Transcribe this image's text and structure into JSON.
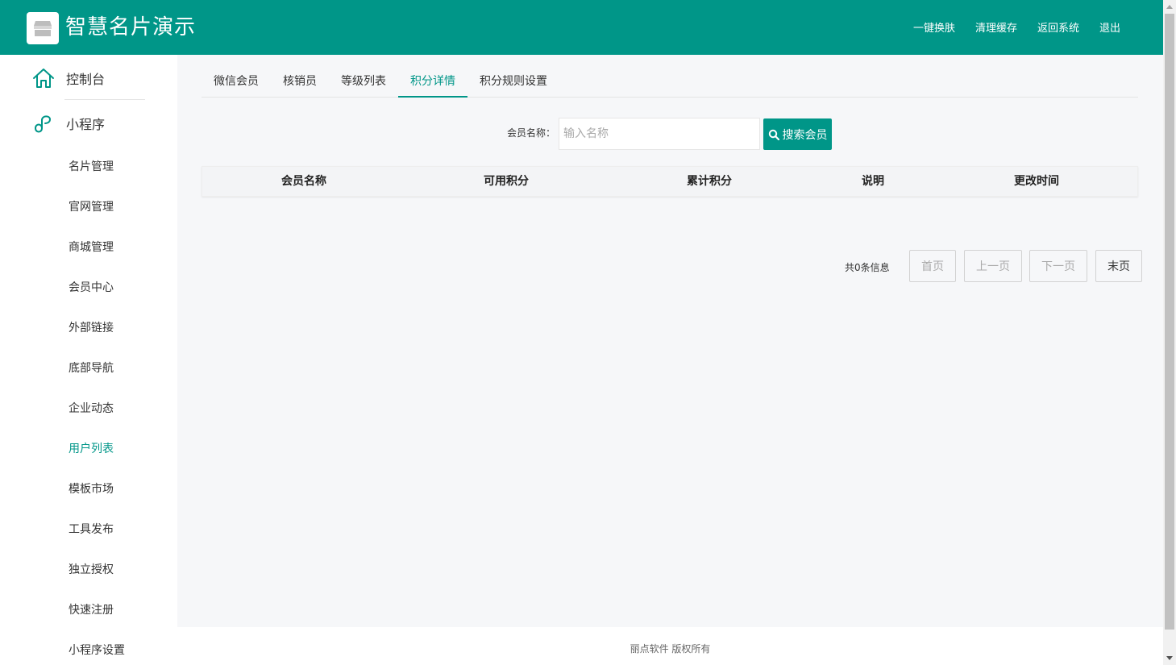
{
  "header": {
    "title": "智慧名片演示",
    "nav": [
      "一键换肤",
      "清理缓存",
      "返回系统",
      "退出"
    ]
  },
  "sidebar": {
    "console": "控制台",
    "miniprogram": "小程序",
    "items": [
      "名片管理",
      "官网管理",
      "商城管理",
      "会员中心",
      "外部链接",
      "底部导航",
      "企业动态",
      "用户列表",
      "模板市场",
      "工具发布",
      "独立授权",
      "快速注册",
      "小程序设置"
    ],
    "active_item": "用户列表"
  },
  "tabs": {
    "items": [
      "微信会员",
      "核销员",
      "等级列表",
      "积分详情",
      "积分规则设置"
    ],
    "active": "积分详情"
  },
  "search": {
    "label": "会员名称：",
    "placeholder": "输入名称",
    "value": "",
    "button": "搜索会员"
  },
  "table": {
    "columns": [
      "会员名称",
      "可用积分",
      "累计积分",
      "说明",
      "更改时间"
    ],
    "rows": []
  },
  "pagination": {
    "info": "共0条信息",
    "first": "首页",
    "prev": "上一页",
    "next": "下一页",
    "last": "末页"
  },
  "footer": {
    "text": "丽点软件 版权所有"
  },
  "colors": {
    "primary": "#009688",
    "content_bg": "#f6f7f9"
  }
}
